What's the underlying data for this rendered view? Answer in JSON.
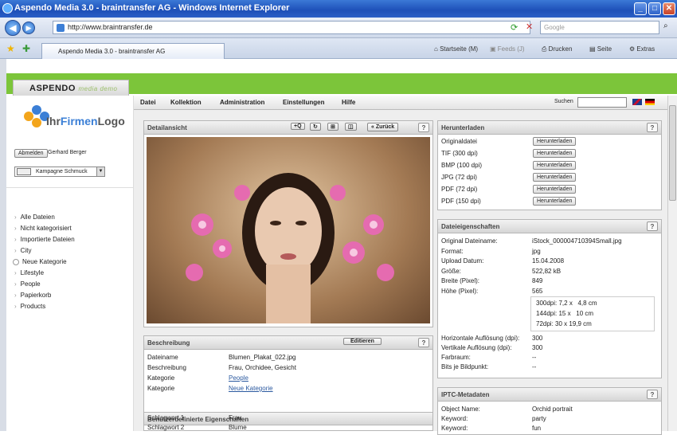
{
  "window": {
    "title": "Aspendo Media 3.0 - braintransfer AG - Windows Internet Explorer"
  },
  "addressbar": {
    "url": "http://www.braintransfer.de",
    "search_placeholder": "Google"
  },
  "tabbar": {
    "tab_label": "Aspendo Media 3.0 - braintransfer AG",
    "startseite": "Startseite (M)",
    "feeds": "Feeds (J)",
    "drucken": "Drucken",
    "seite": "Seite",
    "extras": "Extras"
  },
  "app": {
    "brand": "ASPENDO",
    "brand_sub": "media demo",
    "logo": {
      "prefix": "Ihr",
      "highlight": "Firmen",
      "suffix": "Logo"
    },
    "logout_label": "Abmelden",
    "user": "Gerhard Berger",
    "campaign": "Kampagne Schmuck",
    "nav": [
      "Alle Dateien",
      "Nicht kategorisiert",
      "Importierte Dateien",
      "City",
      "Neue Kategorie",
      "Lifestyle",
      "People",
      "Papierkorb",
      "Products"
    ],
    "menu": [
      "Datei",
      "Kollektion",
      "Administration",
      "Einstellungen",
      "Hilfe"
    ],
    "search_label": "Suchen"
  },
  "detail": {
    "title": "Detailansicht",
    "back_label": "« Zurück",
    "help": "?"
  },
  "description": {
    "title": "Beschreibung",
    "edit_label": "Editieren",
    "help": "?",
    "rows": [
      {
        "k": "Dateiname",
        "v": "Blumen_Plakat_022.jpg"
      },
      {
        "k": "Beschreibung",
        "v": "Frau, Orchidee, Gesicht"
      },
      {
        "k": "Kategorie",
        "v": "People",
        "link": true
      },
      {
        "k": "Kategorie",
        "v": "Neue Kategorie",
        "link": true
      }
    ],
    "custom_title": "Benutzerdefinierte Eigenschaften",
    "custom_rows": [
      {
        "k": "Schlagwort 1",
        "v": "Frau"
      },
      {
        "k": "Schlagwort 2",
        "v": "Blume"
      }
    ]
  },
  "download": {
    "title": "Herunterladen",
    "help": "?",
    "button_label": "Herunterladen",
    "rows": [
      "Originaldatei",
      "TIF (300 dpi)",
      "BMP (100 dpi)",
      "JPG (72 dpi)",
      "PDF (72 dpi)",
      "PDF (150 dpi)"
    ]
  },
  "props": {
    "title": "Dateieigenschaften",
    "help": "?",
    "rows": [
      {
        "k": "Original Dateiname:",
        "v": "iStock_000004710394Small.jpg"
      },
      {
        "k": "Format:",
        "v": "jpg"
      },
      {
        "k": "Upload Datum:",
        "v": "15.04.2008"
      },
      {
        "k": "Größe:",
        "v": "522,82 kB"
      },
      {
        "k": "Breite (Pixel):",
        "v": "849"
      },
      {
        "k": "Höhe (Pixel):",
        "v": "565"
      }
    ],
    "sizes": [
      "300dpi: 7,2 x   4,8 cm",
      "144dpi: 15 x   10 cm",
      "72dpi: 30 x 19,9 cm"
    ],
    "rows2": [
      {
        "k": "Horizontale Auflösung (dpi):",
        "v": "300"
      },
      {
        "k": "Vertikale Auflösung (dpi):",
        "v": "300"
      },
      {
        "k": "Farbraum:",
        "v": "--"
      },
      {
        "k": "Bits je Bildpunkt:",
        "v": "--"
      }
    ]
  },
  "iptc": {
    "title": "IPTC-Metadaten",
    "help": "?",
    "rows": [
      {
        "k": "Object Name:",
        "v": "Orchid portrait"
      },
      {
        "k": "Keyword:",
        "v": "party"
      },
      {
        "k": "Keyword:",
        "v": "fun"
      }
    ]
  }
}
